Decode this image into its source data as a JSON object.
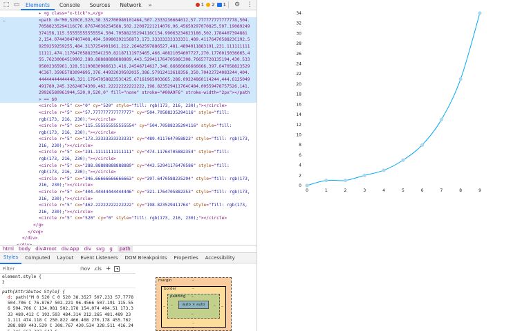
{
  "devtools": {
    "tabs": [
      "Elements",
      "Console",
      "Sources",
      "Network"
    ],
    "more": "»",
    "error_count": "1",
    "warning_count": "2",
    "info_count": "1",
    "dom_lines_before": [
      {
        "indent": 7,
        "html": "▸ <g class=\"x-tick\">…</g>"
      }
    ],
    "selected_path": {
      "ellipsis": "…",
      "text": "<path d=\"M0,520C0,520,38.352700980101464,507.2333236664012,57.777777777777778,504.70588235294116C76.87674036254588,502.22087221214076,96.45659297070825,507.19089249374156,115.55555555555554,504.70588235294116C134.99063234623186,502.17844073948812,154.07443047407408,494.50980392156873,173.33333333333331,489.4117647058823C192.59259259259255,484.3137254901961,212.26462597886527,481.4894011883191,231.11111111111111,474.11764705882354C250.82187111973465,466.40821054607727,270.1776015036665,455.76230084519902,288.88888888888889,443.52941176470586C308.76657728135194,430.53395802365961,328.51100830986613,416.24548714627,346.66666666666666,397.6470588235294C367.35965783094695,376.44932039502035,386.57912412618356,350.70422724083244,404.44444444444446,321.1764705882353C425.67161965003665,286.09224860114244,444.6125049491789,245.32624674309,462.22222222222222,198.823529411764C484.00559478757526,141.29926580961944,520,0,520,0\" fill=\"none\" stroke=\"#00A9F6\" stroke-width=\"2px\"></path> == $0"
    },
    "circles": [
      {
        "cx": "0",
        "cy": "520"
      },
      {
        "cx": "57.777777777777777",
        "cy": "504.70588235294116"
      },
      {
        "cx": "115.555555555555554",
        "cy": "504.70588235294116"
      },
      {
        "cx": "173.33333333333331",
        "cy": "489.4117647058823"
      },
      {
        "cx": "231.11111111111111",
        "cy": "474.11764705882354"
      },
      {
        "cx": "288.88888888888889",
        "cy": "443.52941176470586"
      },
      {
        "cx": "346.66666666666663",
        "cy": "397.6470588235294"
      },
      {
        "cx": "404.44444444444446",
        "cy": "321.1764705882353"
      },
      {
        "cx": "462.22222222222222",
        "cy": "198.823529411764"
      },
      {
        "cx": "520",
        "cy": "0"
      }
    ],
    "circle_r": "5",
    "circle_style": "fill: rgb(173, 216, 230);",
    "closing_lines": [
      {
        "indent": 6,
        "text": "</g>"
      },
      {
        "indent": 5,
        "text": "</svg>"
      },
      {
        "indent": 4,
        "text": "</div>"
      },
      {
        "indent": 3,
        "text": "</div>"
      },
      {
        "indent": 2,
        "text": "</div>"
      },
      {
        "indent": 2,
        "text": "<!--"
      },
      {
        "indent": 4,
        "text": "This HTML file is a template."
      }
    ],
    "breadcrumbs": [
      "html",
      "body",
      "div#root",
      "div.App",
      "div",
      "svg",
      "g",
      "path"
    ],
    "subtabs": [
      "Styles",
      "Computed",
      "Layout",
      "Event Listeners",
      "DOM Breakpoints",
      "Properties",
      "Accessibility"
    ],
    "filter_placeholder": "Filter",
    "hov": ":hov",
    "cls": ".cls",
    "plus": "+",
    "styles": {
      "element_style_open": "element.style {",
      "element_style_close": "}",
      "rule_selector": "path[Attributes Style] {",
      "prop_name": "d",
      "prop_value": "path(\"M 0 520 C 0 520 38.3527 507.233 57.7778 504.706 C 76.8767 502.221 96.4566 507.191 115.556 504.706 C 134.981 502.178 154.074 494.51 173.333 489.412 C 192.593 484.314 212.265 481.489 231.111 474.118 C 250.822 466.408 270.178 455.762 288.889 443.529 C 308.767 430.534 328.511 416.245 346.667 397.647 C"
    },
    "box_model": {
      "margin": "margin",
      "border": "border",
      "padding": "padding",
      "content": "auto × auto",
      "dash": "–"
    }
  },
  "chart_data": {
    "type": "line",
    "x": [
      0,
      1,
      2,
      3,
      4,
      5,
      6,
      7,
      8,
      9
    ],
    "series": [
      {
        "values": [
          0,
          1,
          1,
          2,
          3,
          5,
          8,
          13,
          21,
          34
        ]
      }
    ],
    "x_ticks": [
      "0",
      "1",
      "2",
      "3",
      "4",
      "5",
      "6",
      "7",
      "8",
      "9"
    ],
    "y_ticks": [
      "0",
      "2",
      "4",
      "6",
      "8",
      "10",
      "12",
      "14",
      "16",
      "18",
      "20",
      "22",
      "24",
      "26",
      "28",
      "30",
      "32",
      "34"
    ],
    "xlim": [
      0,
      9
    ],
    "ylim": [
      0,
      34
    ],
    "line_color": "#00A9F6",
    "point_color": "#add8e6",
    "grid": false,
    "legend": "none"
  }
}
